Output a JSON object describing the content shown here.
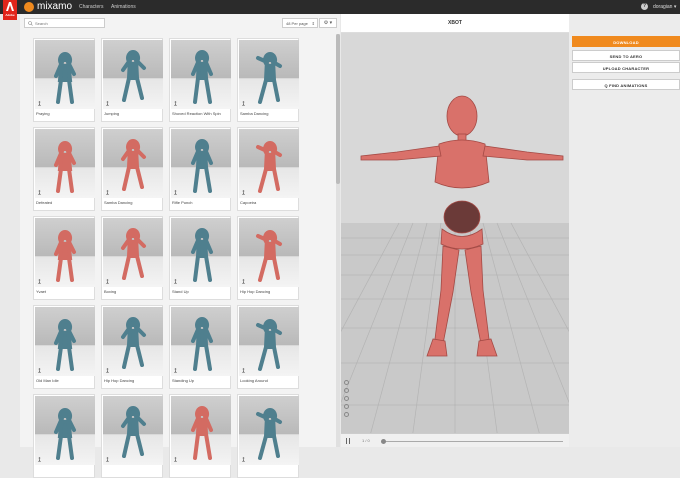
{
  "topbar": {
    "adobe_label": "Adobe",
    "app_name": "mixamo",
    "nav": [
      "Characters",
      "Animations"
    ],
    "user": "doragian ▾",
    "help": "?"
  },
  "search": {
    "placeholder": "Search"
  },
  "perpage": {
    "value": "48 Per page"
  },
  "gear_label": "⚙ ▾",
  "cards": [
    {
      "label": "Praying",
      "color": "#4f7f8e"
    },
    {
      "label": "Jumping",
      "color": "#4f7f8e"
    },
    {
      "label": "Shoved Reaction With Spin",
      "color": "#4f7f8e"
    },
    {
      "label": "Samba Dancing",
      "color": "#4f7f8e"
    },
    {
      "label": "Defeated",
      "color": "#d36b62"
    },
    {
      "label": "Samba Dancing",
      "color": "#d36b62"
    },
    {
      "label": "Rifle Punch",
      "color": "#4f7f8e"
    },
    {
      "label": "Capoeira",
      "color": "#d36b62"
    },
    {
      "label": "Yvaet",
      "color": "#d36b62"
    },
    {
      "label": "Boxing",
      "color": "#d36b62"
    },
    {
      "label": "Stand Up",
      "color": "#4f7f8e"
    },
    {
      "label": "Hip Hop Dancing",
      "color": "#d36b62"
    },
    {
      "label": "Old Man Idle",
      "color": "#4f7f8e"
    },
    {
      "label": "Hip Hop Dancing",
      "color": "#4f7f8e"
    },
    {
      "label": "Standing Up",
      "color": "#4f7f8e"
    },
    {
      "label": "Looking Around",
      "color": "#4f7f8e"
    },
    {
      "label": "",
      "color": "#4f7f8e"
    },
    {
      "label": "",
      "color": "#4f7f8e"
    },
    {
      "label": "",
      "color": "#d36b62"
    },
    {
      "label": "",
      "color": "#4f7f8e"
    }
  ],
  "viewer": {
    "title": "XBOT",
    "frame": "1 / 0"
  },
  "actions": {
    "download": "DOWNLOAD",
    "send": "SEND TO AERO",
    "upload": "UPLOAD CHARACTER",
    "find": "Q FIND ANIMATIONS"
  },
  "colors": {
    "accent": "#f08a1e",
    "adobe_red": "#e1251b",
    "xbot_red": "#d36b62",
    "ybot_teal": "#4f7f8e"
  }
}
